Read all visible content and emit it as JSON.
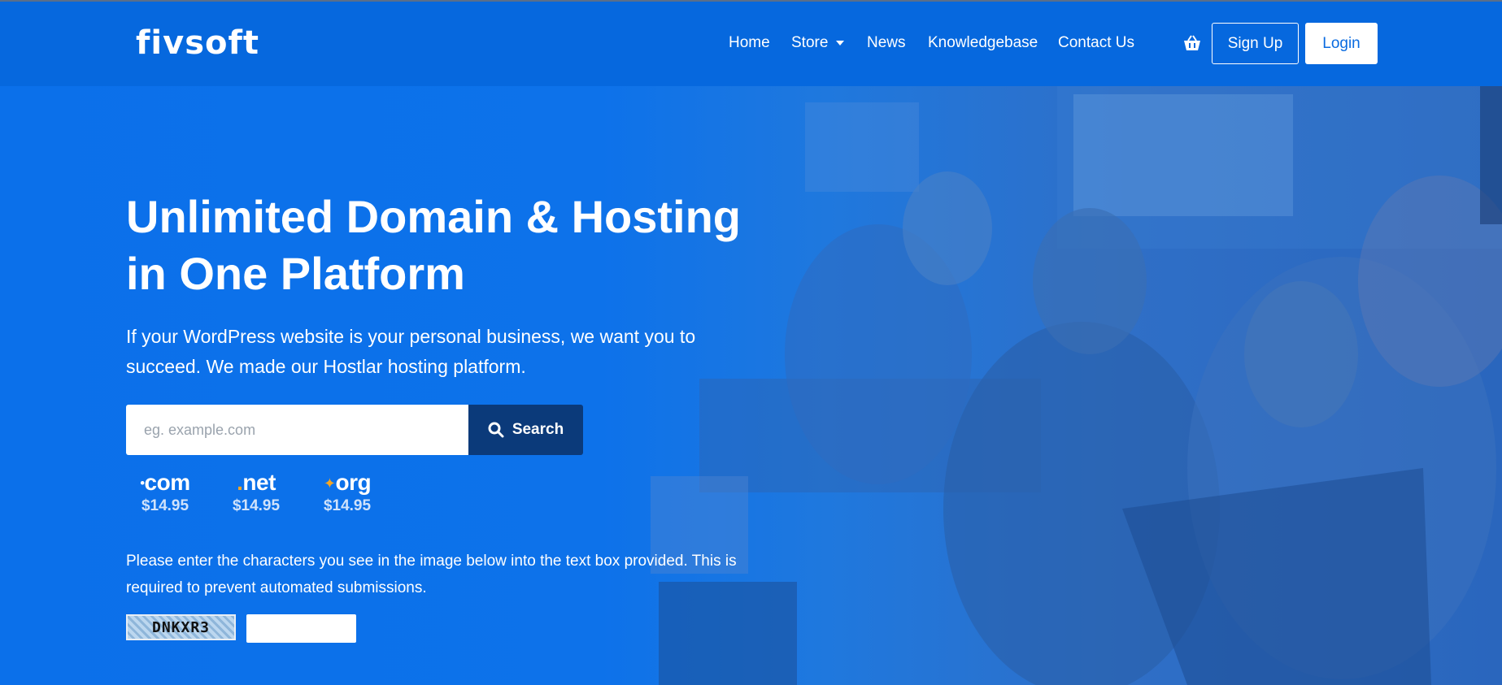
{
  "brand": {
    "logo_text": "FIVSOFT"
  },
  "nav": {
    "items": [
      {
        "label": "Home"
      },
      {
        "label": "Store",
        "has_dropdown": true
      },
      {
        "label": "News"
      },
      {
        "label": "Knowledgebase"
      },
      {
        "label": "Contact Us"
      }
    ],
    "cart_icon": "basket-icon",
    "signup_label": "Sign Up",
    "login_label": "Login"
  },
  "hero": {
    "title": "Unlimited Domain & Hosting in One Platform",
    "subtitle": "If your WordPress website is your personal business, we want you to succeed. We made our Hostlar hosting platform.",
    "search": {
      "placeholder": "eg. example.com",
      "button_label": "Search",
      "button_icon": "search-icon"
    },
    "tlds": [
      {
        "prefix": "•",
        "name": "com",
        "price": "$14.95"
      },
      {
        "prefix": ".",
        "name": "net",
        "price": "$14.95"
      },
      {
        "prefix": "✦",
        "name": "org",
        "price": "$14.95"
      }
    ],
    "captcha": {
      "instructions": "Please enter the characters you see in the image below into the text box provided. This is required to prevent automated submissions.",
      "code": "DNKXR3"
    }
  },
  "colors": {
    "header_bg": "#0668de",
    "hero_bg": "#0b70ea",
    "search_button_bg": "#0b3a7a",
    "tld_dot_accent": "#f5a623"
  }
}
